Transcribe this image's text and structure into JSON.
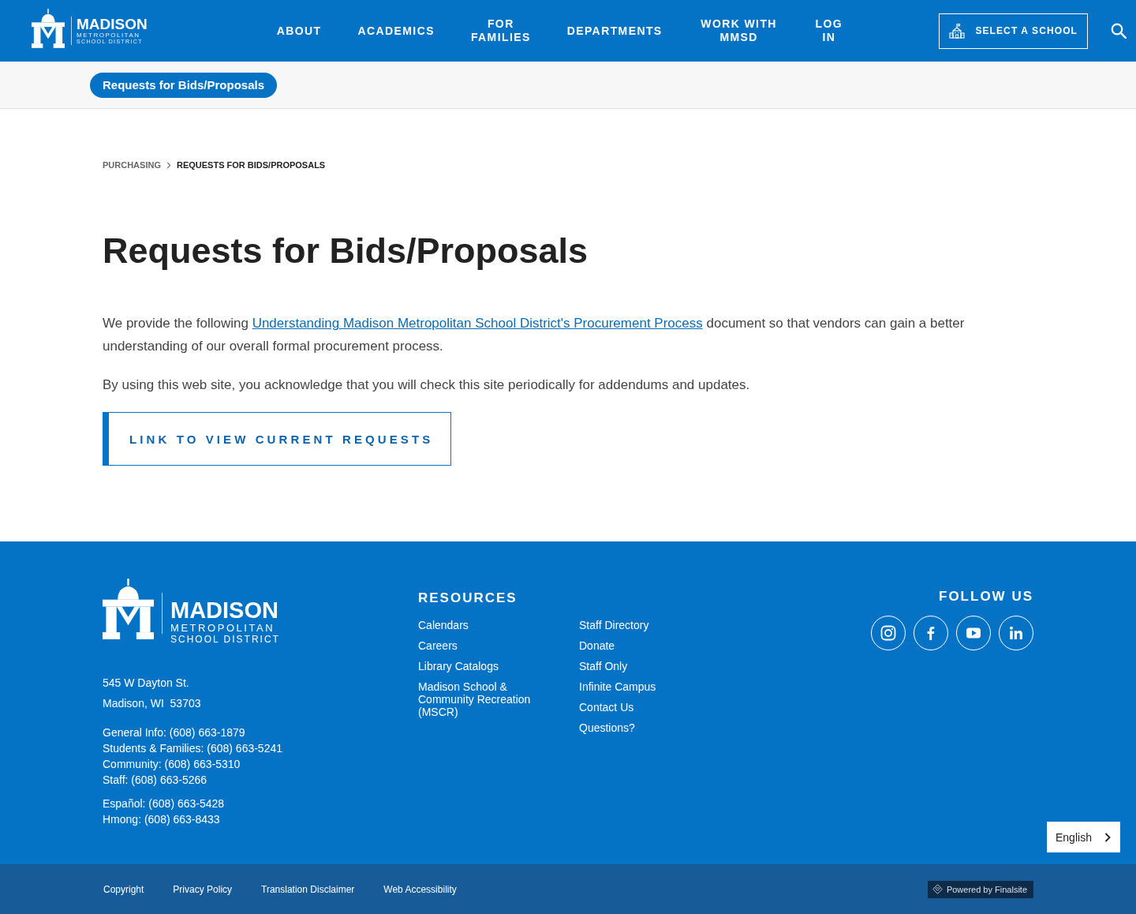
{
  "header": {
    "logo": {
      "name": "MADISON",
      "line_1": "METROPOLITAN",
      "line_2": "SCHOOL DISTRICT"
    },
    "nav": [
      {
        "label": "ABOUT"
      },
      {
        "label": "ACADEMICS"
      },
      {
        "label": "FOR FAMILIES"
      },
      {
        "label": "DEPARTMENTS"
      },
      {
        "label": "WORK WITH MMSD"
      },
      {
        "label": "LOG IN"
      }
    ],
    "select_school": {
      "label": "SELECT A SCHOOL"
    }
  },
  "subnav": {
    "items": [
      {
        "label": "Requests for Bids/Proposals",
        "selected": true
      }
    ]
  },
  "breadcrumb": [
    {
      "label": "PURCHASING",
      "current": false
    },
    {
      "label": "REQUESTS FOR BIDS/PROPOSALS",
      "current": true
    }
  ],
  "page": {
    "title": "Requests for Bids/Proposals",
    "paragraphs": [
      {
        "parts": [
          {
            "kind": "text",
            "text": "We provide the following "
          },
          {
            "kind": "link",
            "text": "Understanding Madison Metropolitan School District's Procurement Process"
          },
          {
            "kind": "text",
            "text": " document so that vendors can gain a better understanding of our overall formal procurement process."
          }
        ]
      },
      {
        "parts": [
          {
            "kind": "text",
            "text": "By using this web site, you acknowledge that you will check this site periodically for addendums and updates."
          }
        ]
      }
    ],
    "cta_button": {
      "label": "LINK TO VIEW CURRENT REQUESTS"
    }
  },
  "footer": {
    "logo": {
      "name": "MADISON",
      "line_1": "METROPOLITAN",
      "line_2": "SCHOOL DISTRICT"
    },
    "address": [
      "545 W Dayton St.",
      "Madison, WI  53703"
    ],
    "phone_groups": [
      [
        "General Info: (608) 663-1879",
        "Students & Families: (608) 663-5241",
        "Community: (608) 663-5310",
        "Staff: (608) 663-5266"
      ],
      [
        "Español: (608) 663-5428",
        "Hmong: (608) 663-8433"
      ]
    ],
    "resources": {
      "heading": "RESOURCES",
      "columns": [
        [
          "Calendars",
          "Careers",
          "Library Catalogs",
          "Madison School & Community Recreation (MSCR)"
        ],
        [
          "Staff Directory",
          "Donate",
          "Staff Only",
          "Infinite Campus",
          "Contact Us",
          "Questions?"
        ]
      ]
    },
    "follow_us": {
      "heading": "FOLLOW US",
      "links": [
        {
          "kind": "instagram"
        },
        {
          "kind": "facebook"
        },
        {
          "kind": "youtube"
        },
        {
          "kind": "linkedin"
        }
      ]
    },
    "language": {
      "label": "English"
    }
  },
  "bottom_bar": {
    "links": [
      "Copyright",
      "Privacy Policy",
      "Translation Disclaimer",
      "Web Accessibility"
    ],
    "powered_by": "Powered by Finalsite"
  }
}
